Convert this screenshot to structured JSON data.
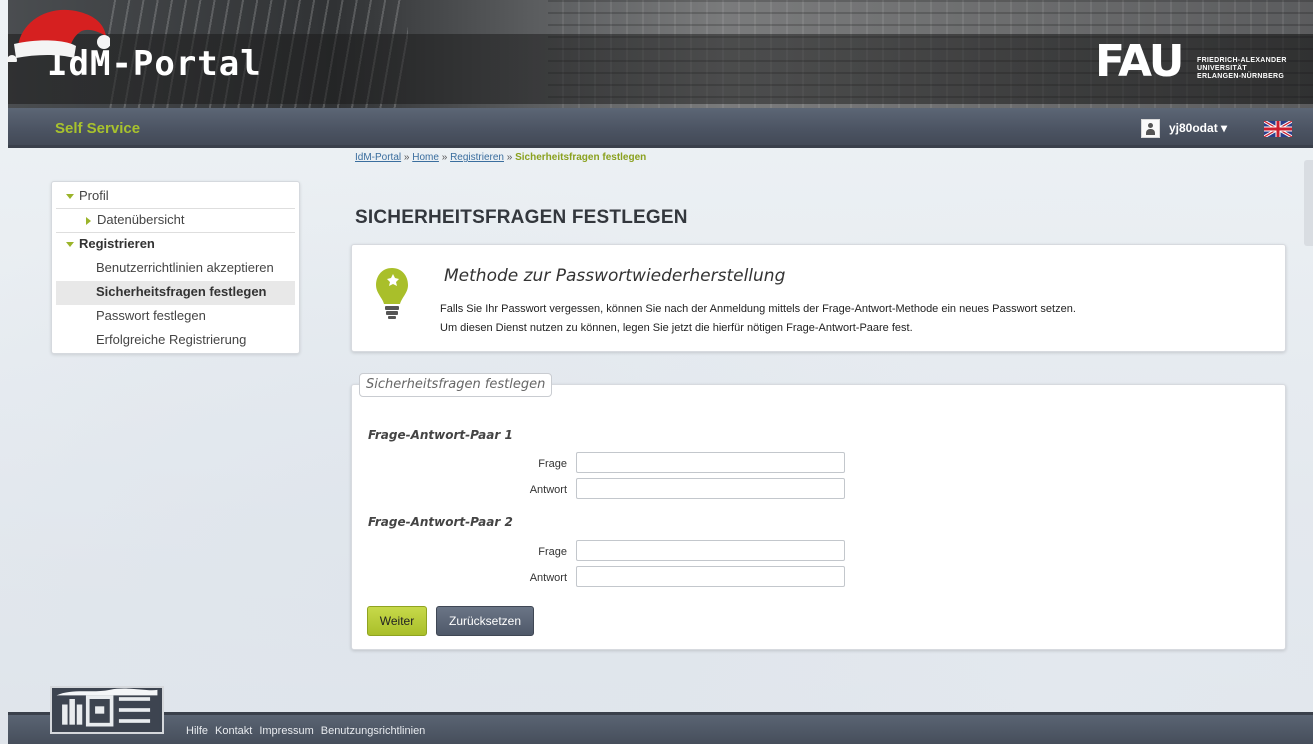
{
  "header": {
    "portal_title": "IdM-Portal",
    "fau_letters": "FAU",
    "fau_line1": "FRIEDRICH-ALEXANDER",
    "fau_line2": "UNIVERSITÄT",
    "fau_line3": "ERLANGEN-NÜRNBERG"
  },
  "navbar": {
    "brand": "Self Service",
    "username": "yj80odat ▾"
  },
  "breadcrumb": {
    "home_portal": "IdM-Portal",
    "sep": " » ",
    "home": "Home",
    "register": "Registrieren",
    "current": "Sicherheitsfragen festlegen"
  },
  "sidebar": {
    "items": [
      {
        "label": "Profil"
      },
      {
        "label": "Datenübersicht"
      },
      {
        "label": "Registrieren"
      },
      {
        "label": "Benutzerrichtlinien akzeptieren"
      },
      {
        "label": "Sicherheitsfragen festlegen"
      },
      {
        "label": "Passwort festlegen"
      },
      {
        "label": "Erfolgreiche Registrierung"
      }
    ]
  },
  "main": {
    "title": "SICHERHEITSFRAGEN FESTLEGEN",
    "info": {
      "heading": "Methode zur Passwortwiederherstellung",
      "line1": "Falls Sie Ihr Passwort vergessen, können Sie nach der Anmeldung mittels der Frage-Antwort-Methode ein neues Passwort setzen.",
      "line2": "Um diesen Dienst nutzen zu können, legen Sie jetzt die hierfür nötigen Frage-Antwort-Paare fest."
    },
    "form": {
      "legend": "Sicherheitsfragen festlegen",
      "pair1_title": "Frage-Antwort-Paar 1",
      "pair2_title": "Frage-Antwort-Paar 2",
      "question_label": "Frage",
      "answer_label": "Antwort",
      "pair1_question": "",
      "pair1_answer": "",
      "pair2_question": "",
      "pair2_answer": "",
      "submit_label": "Weiter",
      "reset_label": "Zurücksetzen"
    }
  },
  "footer": {
    "links": [
      "Hilfe",
      "Kontakt",
      "Impressum",
      "Benutzungsrichtlinien"
    ]
  },
  "colors": {
    "accent_green": "#a9bf2a",
    "nav_bg": "#4b5362",
    "brand_green": "#a8c22d"
  }
}
